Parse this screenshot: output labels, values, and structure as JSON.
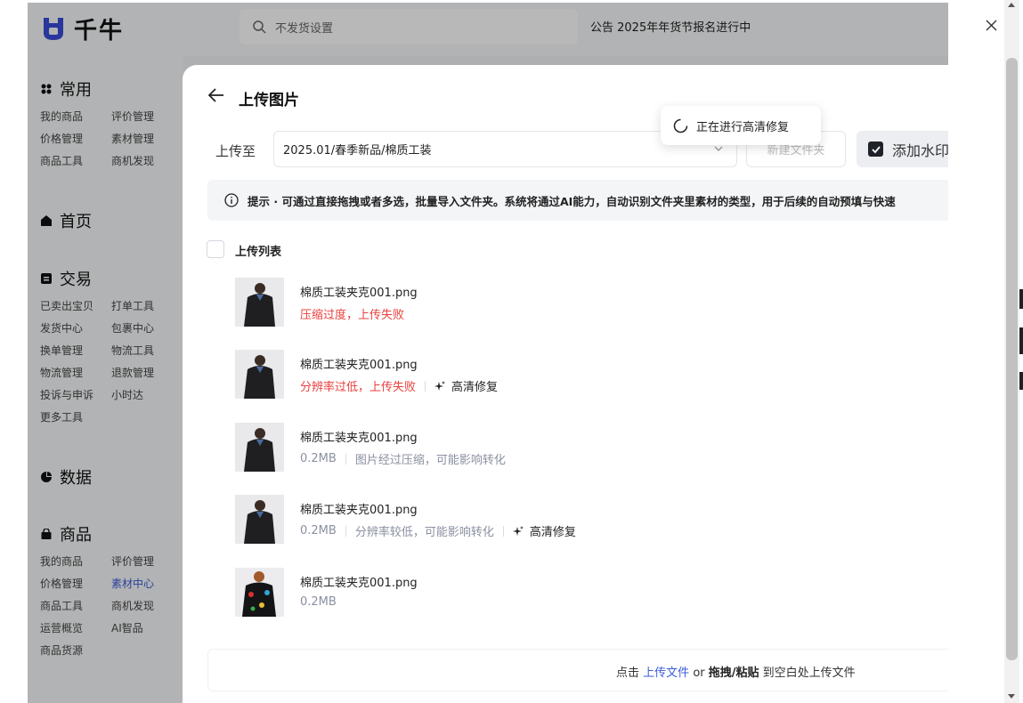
{
  "app": {
    "logo_text": "千牛",
    "search_placeholder": "不发货设置",
    "notice": "公告 2025年年货节报名进行中"
  },
  "sidebar": {
    "sections": [
      {
        "title": "常用",
        "icon": "grid-icon",
        "items": [
          "我的商品",
          "评价管理",
          "价格管理",
          "素材管理",
          "商品工具",
          "商机发现"
        ]
      },
      {
        "title": "首页",
        "icon": "home-icon",
        "items": []
      },
      {
        "title": "交易",
        "icon": "receipt-icon",
        "items": [
          "已卖出宝贝",
          "打单工具",
          "发货中心",
          "包裹中心",
          "换单管理",
          "物流工具",
          "物流管理",
          "退款管理",
          "投诉与申诉",
          "小时达",
          "更多工具"
        ]
      },
      {
        "title": "数据",
        "icon": "pie-chart-icon",
        "items": []
      },
      {
        "title": "商品",
        "icon": "bag-icon",
        "items": [
          "我的商品",
          "评价管理",
          "价格管理",
          "素材中心",
          "商品工具",
          "商机发现",
          "运营概览",
          "AI智品",
          "商品货源"
        ],
        "active": "素材中心"
      }
    ]
  },
  "panel": {
    "title": "上传图片",
    "upload_to_label": "上传至",
    "folder_value": "2025.01/春季新品/棉质工装",
    "new_folder": "新建文件夹",
    "watermark_label": "添加水印",
    "watermark_checked": true,
    "toast": "正在进行高清修复",
    "tip": "提示 · 可通过直接拖拽或者多选，批量导入文件夹。系统将通过AI能力，自动识别文件夹里素材的类型，用于后续的自动预填与快速",
    "list_title": "上传列表",
    "files": [
      {
        "name": "棉质工装夹克001.png",
        "status": "压缩过度，上传失败",
        "status_type": "error",
        "fix": ""
      },
      {
        "name": "棉质工装夹克001.png",
        "status": "分辨率过低，上传失败",
        "status_type": "error",
        "fix": "高清修复"
      },
      {
        "name": "棉质工装夹克001.png",
        "size": "0.2MB",
        "status": "图片经过压缩，可能影响转化",
        "status_type": "info",
        "fix": ""
      },
      {
        "name": "棉质工装夹克001.png",
        "size": "0.2MB",
        "status": "分辨率较低，可能影响转化",
        "status_type": "info",
        "fix": "高清修复"
      },
      {
        "name": "棉质工装夹克001.png",
        "size": "0.2MB",
        "status": "",
        "status_type": "info",
        "fix": ""
      }
    ],
    "dropzone": {
      "prefix": "点击",
      "link": "上传文件",
      "mid": "or",
      "strong": "拖拽/粘贴",
      "suffix": "到空白处上传文件"
    }
  },
  "colors": {
    "accent": "#3b5bdb",
    "error": "#e8413d",
    "muted": "#8a90a0"
  }
}
